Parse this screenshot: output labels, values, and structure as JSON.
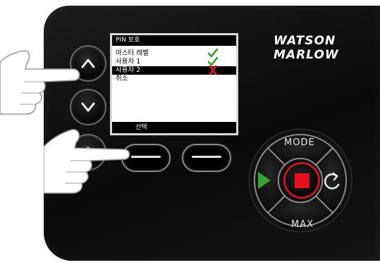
{
  "screen": {
    "title": "PIN 보호",
    "items": [
      {
        "label": "마스터 레벨",
        "mark": "check"
      },
      {
        "label": "사용자 1",
        "mark": "check"
      },
      {
        "label": "사용자 2",
        "mark": "cross",
        "selected": true
      },
      {
        "label": "취소",
        "mark": ""
      }
    ],
    "softkey_label": "선택"
  },
  "logo": {
    "line1": "WATSON",
    "line2": "MARLOW"
  },
  "keys": {
    "mode": "MODE",
    "max": "MAX"
  },
  "colors": {
    "check": "#2e9e22",
    "cross": "#d71920",
    "stop": "#e8101c",
    "run": "#3aa536"
  },
  "icons": [
    "up-arrow-icon",
    "down-arrow-icon",
    "home-icon",
    "play-icon",
    "stop-icon",
    "rotate-icon",
    "check-icon",
    "cross-icon",
    "pointing-hand-icon"
  ]
}
